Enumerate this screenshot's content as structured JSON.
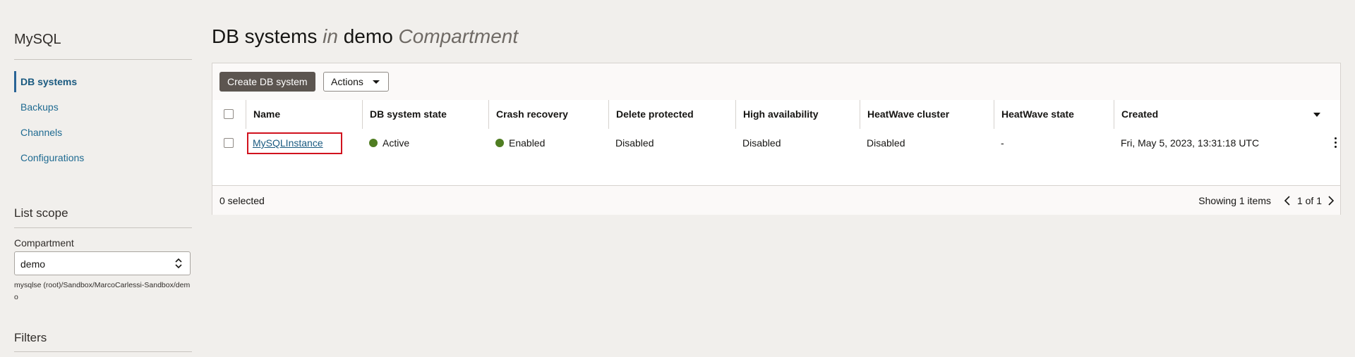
{
  "sidebar": {
    "title": "MySQL",
    "nav": [
      {
        "label": "DB systems",
        "active": true
      },
      {
        "label": "Backups",
        "active": false
      },
      {
        "label": "Channels",
        "active": false
      },
      {
        "label": "Configurations",
        "active": false
      }
    ],
    "list_scope": {
      "heading": "List scope",
      "compartment_label": "Compartment",
      "compartment_value": "demo",
      "compartment_path": "mysqlse (root)/Sandbox/MarcoCarlessi-Sandbox/demo"
    },
    "filters_heading": "Filters"
  },
  "header": {
    "title_main": "DB systems",
    "title_in": "in",
    "title_compartment": "demo",
    "title_suffix": "Compartment"
  },
  "toolbar": {
    "create_label": "Create DB system",
    "actions_label": "Actions"
  },
  "table": {
    "columns": [
      "Name",
      "DB system state",
      "Crash recovery",
      "Delete protected",
      "High availability",
      "HeatWave cluster",
      "HeatWave state",
      "Created"
    ],
    "rows": [
      {
        "name": "MySQLInstance",
        "state": "Active",
        "crash_recovery": "Enabled",
        "delete_protected": "Disabled",
        "high_availability": "Disabled",
        "heatwave_cluster": "Disabled",
        "heatwave_state": "-",
        "created": "Fri, May 5, 2023, 13:31:18 UTC"
      }
    ]
  },
  "footer": {
    "selected": "0 selected",
    "showing": "Showing 1 items",
    "page": "1 of 1"
  },
  "colors": {
    "status_green": "#4f7d21",
    "link": "#1a5a80",
    "highlight_border": "#d1121e",
    "primary_button": "#5c5550"
  }
}
